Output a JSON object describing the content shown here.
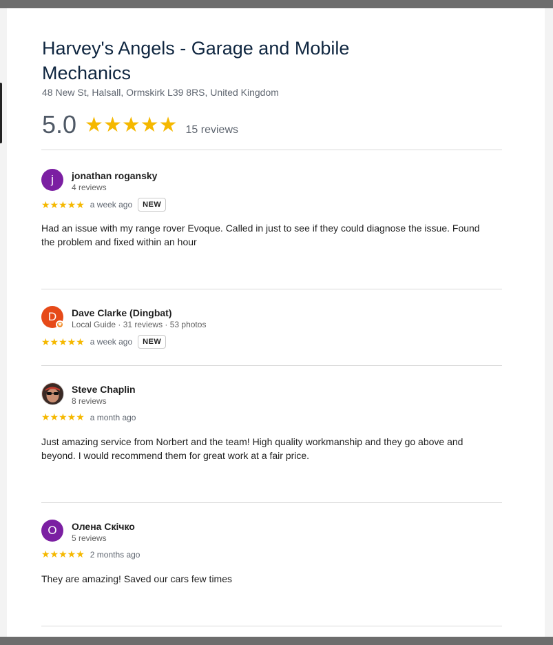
{
  "place": {
    "title": "Harvey's Angels - Garage and Mobile Mechanics",
    "address": "48 New St, Halsall, Ormskirk L39 8RS, United Kingdom",
    "rating": "5.0",
    "rating_stars": "★★★★★",
    "review_count": "15 reviews"
  },
  "colors": {
    "star": "#f5b800",
    "title": "#0f2640",
    "avatar_purple": "#7b1fa2",
    "avatar_orange": "#e64a19"
  },
  "reviews": [
    {
      "avatar_letter": "j",
      "name": "jonathan rogansky",
      "sub": "4 reviews",
      "stars": "★★★★★",
      "time": "a week ago",
      "badge": "NEW",
      "text": "Had an issue with my range rover Evoque. Called in just to see if they could diagnose the issue. Found the problem and fixed within an hour"
    },
    {
      "avatar_letter": "D",
      "name": "Dave Clarke (Dingbat)",
      "sub": "Local Guide · 31 reviews · 53 photos",
      "stars": "★★★★★",
      "time": "a week ago",
      "badge": "NEW",
      "text": ""
    },
    {
      "avatar_letter": "",
      "name": "Steve Chaplin",
      "sub": "8 reviews",
      "stars": "★★★★★",
      "time": "a month ago",
      "badge": "",
      "text": "Just amazing service from Norbert and the team! High quality workmanship and they go above and beyond. I would recommend them for great work at a fair price."
    },
    {
      "avatar_letter": "О",
      "name": "Олена Скічко",
      "sub": "5 reviews",
      "stars": "★★★★★",
      "time": "2 months ago",
      "badge": "",
      "text": "They are amazing! Saved our cars few times"
    }
  ]
}
